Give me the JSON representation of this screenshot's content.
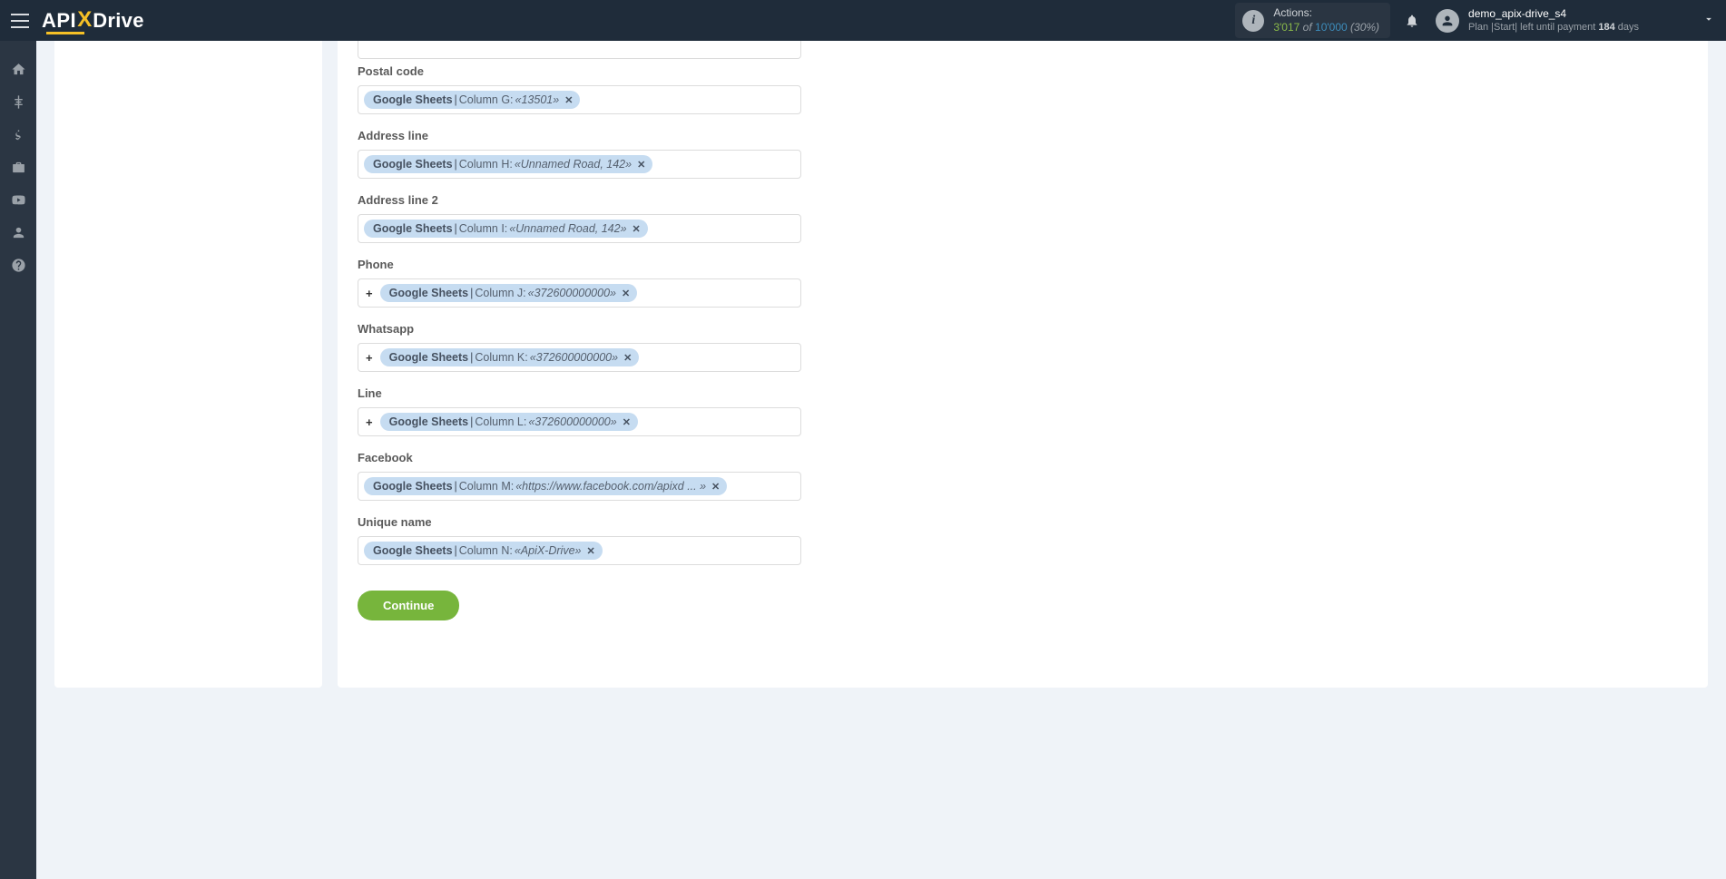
{
  "header": {
    "logo_api": "API",
    "logo_x": "X",
    "logo_drive": "Drive",
    "actions_label": "Actions:",
    "actions_used": "3'017",
    "actions_of": "of",
    "actions_total": "10'000",
    "actions_pct": "(30%)",
    "username": "demo_apix-drive_s4",
    "plan_text": "Plan |Start|  left until payment ",
    "days_num": "184",
    "days_word": " days"
  },
  "fields": [
    {
      "label": "Postal code",
      "prefix": false,
      "source": "Google Sheets",
      "column": "Column G:",
      "value": "«13501»"
    },
    {
      "label": "Address line",
      "prefix": false,
      "source": "Google Sheets",
      "column": "Column H:",
      "value": "«Unnamed Road, 142»"
    },
    {
      "label": "Address line 2",
      "prefix": false,
      "source": "Google Sheets",
      "column": "Column I:",
      "value": "«Unnamed Road, 142»"
    },
    {
      "label": "Phone",
      "prefix": true,
      "source": "Google Sheets",
      "column": "Column J:",
      "value": "«372600000000»"
    },
    {
      "label": "Whatsapp",
      "prefix": true,
      "source": "Google Sheets",
      "column": "Column K:",
      "value": "«372600000000»"
    },
    {
      "label": "Line",
      "prefix": true,
      "source": "Google Sheets",
      "column": "Column L:",
      "value": "«372600000000»"
    },
    {
      "label": "Facebook",
      "prefix": false,
      "source": "Google Sheets",
      "column": "Column M:",
      "value": "«https://www.facebook.com/apixd ... »"
    },
    {
      "label": "Unique name",
      "prefix": false,
      "source": "Google Sheets",
      "column": "Column N:",
      "value": "«ApiX-Drive»"
    }
  ],
  "buttons": {
    "continue": "Continue"
  },
  "phone_plus": "+",
  "tag_close": "✕"
}
